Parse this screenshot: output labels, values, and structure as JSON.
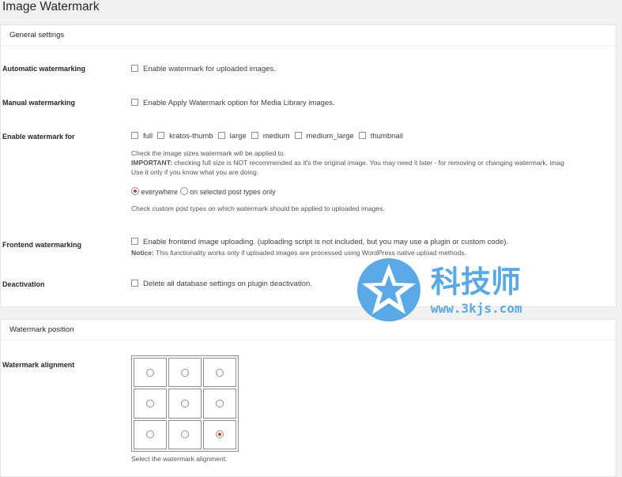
{
  "page": {
    "title": "Image Watermark"
  },
  "general": {
    "heading": "General settings",
    "automatic": {
      "label": "Automatic watermarking",
      "checkbox": "Enable watermark for uploaded images."
    },
    "manual": {
      "label": "Manual watermarking",
      "checkbox": "Enable Apply Watermark option for Media Library images."
    },
    "enable_for": {
      "label": "Enable watermark for",
      "sizes": [
        "full",
        "kratos-thumb",
        "large",
        "medium",
        "medium_large",
        "thumbnail"
      ],
      "desc1": "Check the image sizes watermark will be applied to.",
      "important_strong": "IMPORTANT:",
      "important_text": " checking full size is NOT recommended as it's the original image. You may need it later - for removing or changing watermark, imag",
      "desc3": "Use it only if you know what you are doing.",
      "radio_everywhere": "everywhere",
      "radio_selected": "on selected post types only",
      "desc4": "Check custom post types on which watermark should be applied to uploaded images."
    },
    "frontend": {
      "label": "Frontend watermarking",
      "checkbox": "Enable frontend image uploading. (uploading script is not included, but you may use a plugin or custom code).",
      "notice_strong": "Notice:",
      "notice_text": " This functionality works only if uploaded images are processed using WordPress native upload methods."
    },
    "deactivation": {
      "label": "Deactivation",
      "checkbox": "Delete all database settings on plugin deactivation."
    }
  },
  "position": {
    "heading": "Watermark position",
    "alignment": {
      "label": "Watermark alignment",
      "selected_index": 8,
      "desc": "Select the watermark alignment."
    }
  },
  "watermark_overlay": {
    "brand": "科技师",
    "url": "www.3kjs.com",
    "color": "#5aa9e6"
  }
}
